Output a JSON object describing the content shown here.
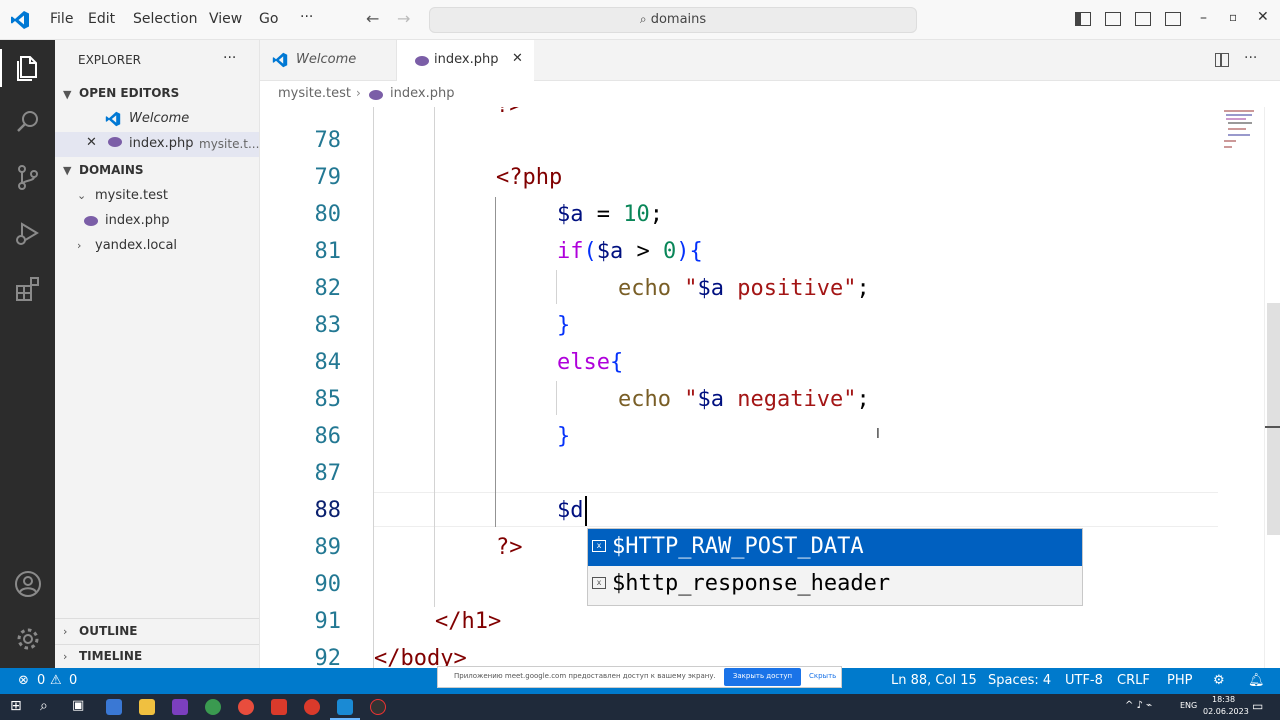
{
  "menu": {
    "file": "File",
    "edit": "Edit",
    "selection": "Selection",
    "view": "View",
    "go": "Go",
    "more": "···"
  },
  "search": {
    "text": "domains"
  },
  "sidebar": {
    "title": "EXPLORER",
    "more": "···",
    "open_editors": "OPEN EDITORS",
    "open_items": [
      {
        "label": "Welcome"
      },
      {
        "label": "index.php",
        "path": "mysite.t..."
      }
    ],
    "folder": "DOMAINS",
    "tree": [
      {
        "label": "mysite.test"
      },
      {
        "label": "index.php"
      },
      {
        "label": "yandex.local"
      }
    ],
    "outline": "OUTLINE",
    "timeline": "TIMELINE"
  },
  "tabs": [
    {
      "label": "Welcome"
    },
    {
      "label": "index.php"
    }
  ],
  "breadcrumb": {
    "folder": "mysite.test",
    "file": "index.php"
  },
  "editor": {
    "partial_top": "?>",
    "lines": [
      {
        "num": "78",
        "text": ""
      },
      {
        "num": "79",
        "text": "<?php"
      },
      {
        "num": "80",
        "text": "$a = 10;"
      },
      {
        "num": "81",
        "text": "if($a > 0){"
      },
      {
        "num": "82",
        "text": "echo \"$a positive\";"
      },
      {
        "num": "83",
        "text": "}"
      },
      {
        "num": "84",
        "text": "else{"
      },
      {
        "num": "85",
        "text": "echo \"$a negative\";"
      },
      {
        "num": "86",
        "text": "}"
      },
      {
        "num": "87",
        "text": ""
      },
      {
        "num": "88",
        "text": "$d"
      },
      {
        "num": "89",
        "text": "?>"
      },
      {
        "num": "90",
        "text": ""
      },
      {
        "num": "91",
        "text": "</h1>"
      },
      {
        "num": "92",
        "text": "</body>"
      }
    ]
  },
  "suggestions": [
    {
      "label": "$HTTP_RAW_POST_DATA",
      "selected": true
    },
    {
      "label": "$http_response_header",
      "selected": false
    }
  ],
  "status": {
    "errors": "0",
    "warnings": "0",
    "notice": "Приложению meet.google.com предоставлен доступ к вашему экрану.",
    "stop_share": "Закрыть доступ",
    "hide": "Скрыть",
    "position": "Ln 88, Col 15",
    "spaces": "Spaces: 4",
    "encoding": "UTF-8",
    "eol": "CRLF",
    "language": "PHP"
  },
  "taskbar": {
    "lang": "ENG",
    "time": "18:38",
    "date": "02.06.2023"
  },
  "colors": {
    "accent": "#007acc",
    "keyword": "#0000ff",
    "string": "#a31515",
    "variable": "#001080",
    "number": "#098658",
    "control": "#af00db"
  }
}
